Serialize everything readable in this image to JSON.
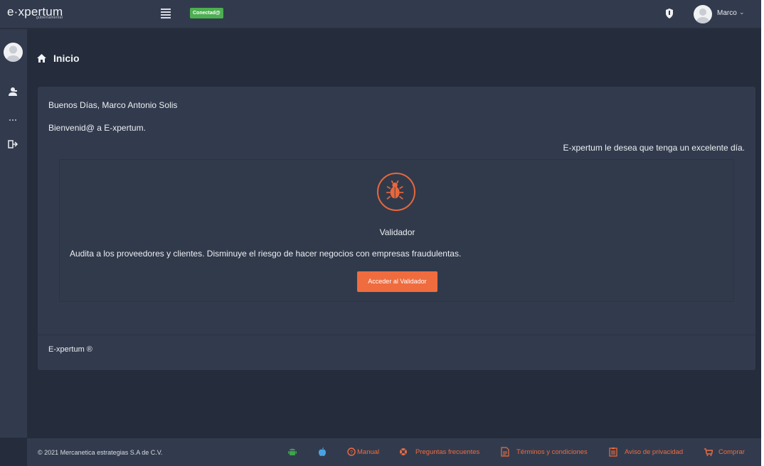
{
  "app": {
    "logo": "e·xpertum",
    "logo_sub": "gubernamental",
    "status": "Conectad@"
  },
  "header": {
    "user_name": "Marco",
    "chevron": "⌄"
  },
  "sidebar": {
    "items": [
      {
        "icon": "user-icon"
      },
      {
        "icon": "more-icon"
      },
      {
        "icon": "logout-icon"
      }
    ]
  },
  "page": {
    "title": "Inicio",
    "greeting": "Buenos Días, Marco Antonio Solis",
    "welcome": "Bienvenid@ a E-xpertum.",
    "wish": "E-xpertum le desea que tenga un excelente día.",
    "validator": {
      "title": "Validador",
      "description": "Audita a los proveedores y clientes. Disminuye el riesgo de hacer negocios con empresas fraudulentas.",
      "button": "Acceder al Validador"
    },
    "card_footer": "E-xpertum ®"
  },
  "footer": {
    "copyright": "© 2021 Mercanetica estrategias S.A de C.V.",
    "links": {
      "manual": "Manual",
      "faq": "Preguntas frecuentes",
      "terms": "Términos y condiciones",
      "privacy": "Aviso de privacidad",
      "buy": "Comprar"
    }
  },
  "colors": {
    "accent": "#ef6c3f",
    "background": "#252c3b",
    "panel": "#323b4d",
    "status_green": "#4caf50"
  }
}
